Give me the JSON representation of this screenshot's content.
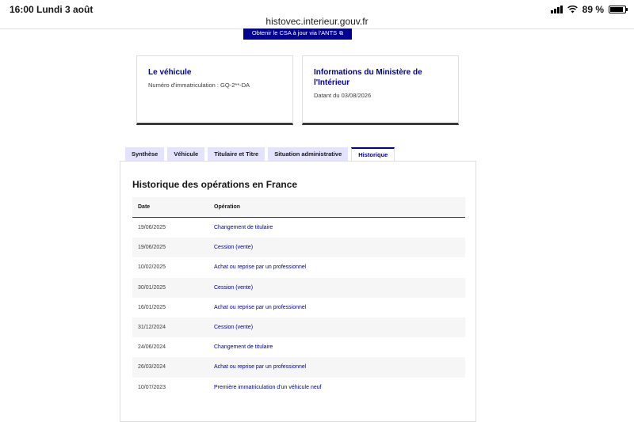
{
  "status_bar": {
    "time": "16:00",
    "date": "Lundi 3 août",
    "battery": "89 %",
    "battery_level": 0.89
  },
  "browser": {
    "url": "histovec.interieur.gouv.fr"
  },
  "ants_button": {
    "label": "Obtenir le CSA à jour via l'ANTS",
    "icon": "external-link-icon"
  },
  "cards": [
    {
      "title": "Le véhicule",
      "text": "Numéro d'immatriculation : GQ-2**-DA"
    },
    {
      "title": "Informations du Ministère de l'Intérieur",
      "text": "Datant du 03/08/2026"
    }
  ],
  "tabs": [
    {
      "label": "Synthèse"
    },
    {
      "label": "Véhicule"
    },
    {
      "label": "Titulaire et Titre"
    },
    {
      "label": "Situation administrative"
    },
    {
      "label": "Historique",
      "active": true
    }
  ],
  "history": {
    "title": "Historique des opérations en France",
    "columns": {
      "date": "Date",
      "operation": "Opération"
    },
    "rows": [
      {
        "date": "19/06/2025",
        "operation": "Changement de titulaire"
      },
      {
        "date": "19/06/2025",
        "operation": "Cession (vente)"
      },
      {
        "date": "10/02/2025",
        "operation": "Achat ou reprise par un professionnel"
      },
      {
        "date": "30/01/2025",
        "operation": "Cession (vente)"
      },
      {
        "date": "16/01/2025",
        "operation": "Achat ou reprise par un professionnel"
      },
      {
        "date": "31/12/2024",
        "operation": "Cession (vente)"
      },
      {
        "date": "24/06/2024",
        "operation": "Changement de titulaire"
      },
      {
        "date": "26/03/2024",
        "operation": "Achat ou reprise par un professionnel"
      },
      {
        "date": "10/07/2023",
        "operation": "Première immatriculation d'un véhicule neuf"
      }
    ]
  },
  "colors": {
    "primary": "#000091",
    "tab_bg": "#e3e3fd",
    "row_alt": "#f6f6f6"
  }
}
